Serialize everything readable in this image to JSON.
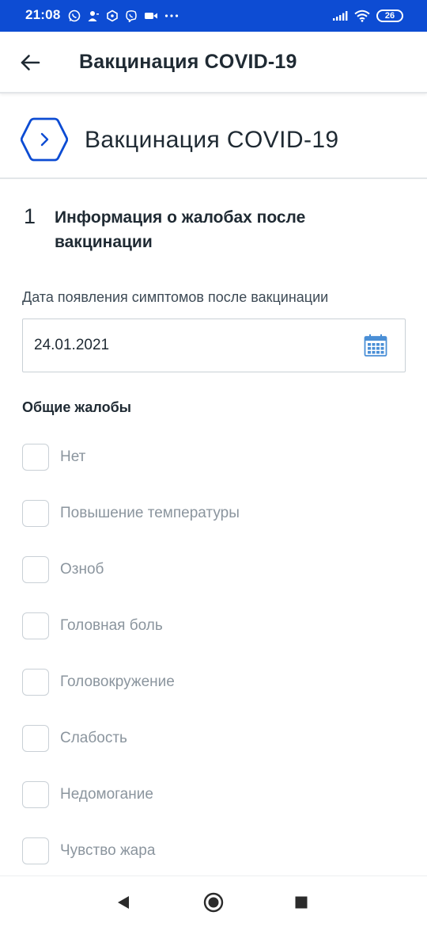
{
  "status_bar": {
    "time": "21:08",
    "battery": "26",
    "icons": [
      "whatsapp-icon",
      "person-icon",
      "hexagon-icon",
      "viber-icon",
      "video-icon",
      "more-dots-icon",
      "signal-icon",
      "wifi-icon",
      "battery-icon"
    ]
  },
  "app_bar": {
    "title": "Вакцинация COVID-19",
    "back_icon": "arrow-left-icon"
  },
  "service": {
    "title": "Вакцинация COVID-19",
    "badge_icon": "chevron-right-icon",
    "accent": "#0d4cd3"
  },
  "step": {
    "number": "1",
    "title": "Информация о жалобах после вакцинации"
  },
  "date_field": {
    "label": "Дата появления симптомов после вакцинации",
    "value": "24.01.2021",
    "icon": "calendar-icon"
  },
  "complaints": {
    "title": "Общие жалобы",
    "options": [
      {
        "label": "Нет",
        "checked": false
      },
      {
        "label": "Повышение температуры",
        "checked": false
      },
      {
        "label": "Озноб",
        "checked": false
      },
      {
        "label": "Головная боль",
        "checked": false
      },
      {
        "label": "Головокружение",
        "checked": false
      },
      {
        "label": "Слабость",
        "checked": false
      },
      {
        "label": "Недомогание",
        "checked": false
      },
      {
        "label": "Чувство жара",
        "checked": false
      }
    ]
  },
  "nav_bar": {
    "icons": [
      "nav-back-icon",
      "nav-home-icon",
      "nav-recents-icon"
    ]
  }
}
